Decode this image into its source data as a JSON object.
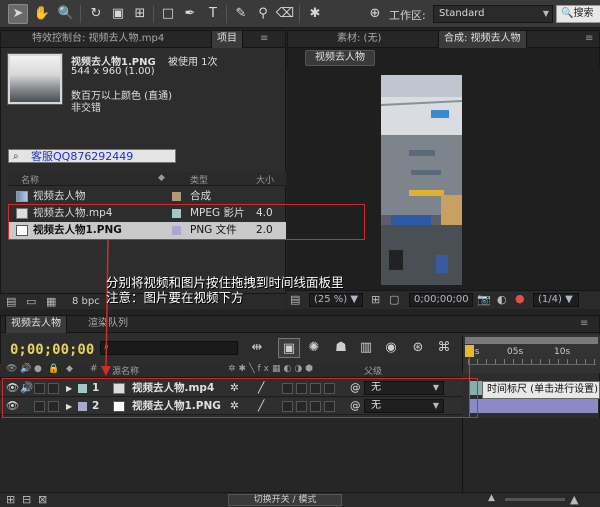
{
  "toolbar": {
    "workspace_label": "工作区:",
    "workspace_value": "Standard",
    "search_label": "搜索"
  },
  "project_panel": {
    "tab_effects": "特效控制台: 视频去人物.mp4",
    "tab_project": "项目",
    "selected_name": "视频去人物1.PNG",
    "used_count": "被使用 1次",
    "dimensions": "544 x 960 (1.00)",
    "color_info": "数百万以上颜色 (直通)",
    "interlace": "非交错",
    "search_text": "客服QQ876292449",
    "columns": {
      "name": "名称",
      "type": "类型",
      "size": "大小"
    },
    "items": [
      {
        "name": "视频去人物",
        "type": "合成",
        "size": "",
        "label_color": "#b09a7a",
        "icon": "composition-icon"
      },
      {
        "name": "视频去人物.mp4",
        "type": "MPEG 影片",
        "size": "4.0",
        "label_color": "#a0c8c8",
        "icon": "video-file-icon"
      },
      {
        "name": "视频去人物1.PNG",
        "type": "PNG 文件",
        "size": "2.0",
        "label_color": "#a8a8d0",
        "icon": "image-file-icon"
      }
    ],
    "bpc": "8 bpc"
  },
  "viewer": {
    "tab_footage": "素材: (无)",
    "tab_comp": "合成: 视频去人物",
    "comp_button": "视频去人物",
    "zoom": "(25 %)",
    "timecode": "0;00;00;00",
    "resolution": "(1/4)"
  },
  "timeline": {
    "tab_comp": "视频去人物",
    "tab_render": "渲染队列",
    "timecode": "0;00;00;00",
    "header_source": "源名称",
    "header_parent": "父级",
    "ruler_labels": [
      "0s",
      "05s",
      "10s"
    ],
    "layers": [
      {
        "num": "1",
        "name": "视频去人物.mp4",
        "parent": "无",
        "label_color": "#a0c8c8",
        "icon": "video-file-icon"
      },
      {
        "num": "2",
        "name": "视频去人物1.PNG",
        "parent": "无",
        "label_color": "#a8a8d0",
        "icon": "image-file-icon"
      }
    ],
    "tooltip": "时间标尺 (单击进行设置)",
    "switch_button": "切换开关 / 模式"
  },
  "annotation": {
    "line1": "分别将视频和图片按住拖拽到时间线面板里",
    "line2": "注意：图片要在视频下方",
    "color": "#d12b2b"
  }
}
